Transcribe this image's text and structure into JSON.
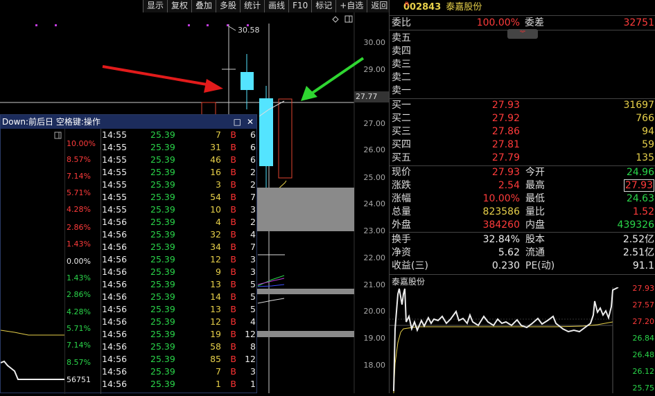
{
  "toolbar": {
    "items": [
      "显示",
      "复权",
      "叠加",
      "多股",
      "统计",
      "画线",
      "F10",
      "标记",
      "+自选",
      "返回"
    ]
  },
  "main_chart": {
    "price_labels": [
      "30.00",
      "29.00",
      "27.00",
      "26.00",
      "25.00",
      "24.00",
      "23.00",
      "22.00",
      "21.00",
      "20.00",
      "19.00",
      "18.00"
    ],
    "current_price_tag": "27.77",
    "high_annotation": "30.58",
    "candles": [
      {
        "open": 27.5,
        "close": 27.9,
        "high": 27.9,
        "low": 27.5,
        "color": "hollow-red"
      },
      {
        "open": 29.0,
        "close": 29.0,
        "high": 30.58,
        "low": 27.5,
        "color": "cross"
      },
      {
        "open": 28.4,
        "close": 29.1,
        "high": 29.55,
        "low": 27.5,
        "color": "cyan"
      },
      {
        "open": 27.95,
        "close": 25.4,
        "high": 28.3,
        "low": 25.2,
        "color": "cyan"
      },
      {
        "open": 25.2,
        "close": 27.95,
        "high": 27.95,
        "low": 25.2,
        "color": "hollow-red"
      }
    ],
    "colors": {
      "bg": "#000000",
      "cyan": "#54e4ff",
      "red": "#e2442f",
      "arrow_red": "#e21b1b",
      "arrow_green": "#2fd631",
      "volume_gray": "#8a8a8a"
    }
  },
  "popup": {
    "title": "Down:前后日 空格键:操作",
    "maximize_icon": "□",
    "close_icon": "✕",
    "pct_labels": [
      {
        "text": "10.00%",
        "color": "red"
      },
      {
        "text": "8.57%",
        "color": "red"
      },
      {
        "text": "7.14%",
        "color": "red"
      },
      {
        "text": "5.71%",
        "color": "red"
      },
      {
        "text": "4.28%",
        "color": "red"
      },
      {
        "text": "2.86%",
        "color": "red"
      },
      {
        "text": "1.43%",
        "color": "red"
      },
      {
        "text": "0.00%",
        "color": "white"
      },
      {
        "text": "1.43%",
        "color": "green"
      },
      {
        "text": "2.86%",
        "color": "green"
      },
      {
        "text": "4.28%",
        "color": "green"
      },
      {
        "text": "5.71%",
        "color": "green"
      },
      {
        "text": "7.14%",
        "color": "green"
      },
      {
        "text": "8.57%",
        "color": "green"
      },
      {
        "text": "56751",
        "color": "white"
      }
    ],
    "trades": [
      {
        "time": "14:55",
        "price": "25.39",
        "vol": "7",
        "side": "B",
        "num": "6"
      },
      {
        "time": "14:55",
        "price": "25.39",
        "vol": "31",
        "side": "B",
        "num": "6"
      },
      {
        "time": "14:55",
        "price": "25.39",
        "vol": "46",
        "side": "B",
        "num": "6"
      },
      {
        "time": "14:55",
        "price": "25.39",
        "vol": "16",
        "side": "B",
        "num": "2"
      },
      {
        "time": "14:55",
        "price": "25.39",
        "vol": "3",
        "side": "B",
        "num": "2"
      },
      {
        "time": "14:55",
        "price": "25.39",
        "vol": "54",
        "side": "B",
        "num": "7"
      },
      {
        "time": "14:55",
        "price": "25.39",
        "vol": "10",
        "side": "B",
        "num": "3"
      },
      {
        "time": "14:56",
        "price": "25.39",
        "vol": "4",
        "side": "B",
        "num": "2"
      },
      {
        "time": "14:56",
        "price": "25.39",
        "vol": "32",
        "side": "B",
        "num": "4"
      },
      {
        "time": "14:56",
        "price": "25.39",
        "vol": "34",
        "side": "B",
        "num": "7"
      },
      {
        "time": "14:56",
        "price": "25.39",
        "vol": "12",
        "side": "B",
        "num": "3"
      },
      {
        "time": "14:56",
        "price": "25.39",
        "vol": "9",
        "side": "B",
        "num": "3"
      },
      {
        "time": "14:56",
        "price": "25.39",
        "vol": "13",
        "side": "B",
        "num": "5"
      },
      {
        "time": "14:56",
        "price": "25.39",
        "vol": "14",
        "side": "B",
        "num": "5"
      },
      {
        "time": "14:56",
        "price": "25.39",
        "vol": "13",
        "side": "B",
        "num": "5"
      },
      {
        "time": "14:56",
        "price": "25.39",
        "vol": "12",
        "side": "B",
        "num": "4"
      },
      {
        "time": "14:56",
        "price": "25.39",
        "vol": "19",
        "side": "B",
        "num": "12"
      },
      {
        "time": "14:56",
        "price": "25.39",
        "vol": "58",
        "side": "B",
        "num": "8"
      },
      {
        "time": "14:56",
        "price": "25.39",
        "vol": "85",
        "side": "B",
        "num": "12"
      },
      {
        "time": "14:56",
        "price": "25.39",
        "vol": "7",
        "side": "B",
        "num": "3"
      },
      {
        "time": "14:56",
        "price": "25.39",
        "vol": "1",
        "side": "B",
        "num": "1"
      }
    ]
  },
  "right_panel": {
    "r_badge": "R",
    "code": "002843",
    "name": "泰嘉股份",
    "weibi_label": "委比",
    "weibi_value": "100.00%",
    "weicha_label": "委差",
    "weicha_value": "32751",
    "sells": [
      "卖五",
      "卖四",
      "卖三",
      "卖二",
      "卖一"
    ],
    "buys": [
      {
        "label": "买一",
        "price": "27.93",
        "vol": "31697"
      },
      {
        "label": "买二",
        "price": "27.92",
        "vol": "766"
      },
      {
        "label": "买三",
        "price": "27.86",
        "vol": "94"
      },
      {
        "label": "买四",
        "price": "27.81",
        "vol": "59"
      },
      {
        "label": "买五",
        "price": "27.79",
        "vol": "135"
      }
    ],
    "stats": [
      {
        "l1": "现价",
        "v1": "27.93",
        "c1": "red",
        "l2": "今开",
        "v2": "24.96",
        "c2": "green"
      },
      {
        "l1": "涨跌",
        "v1": "2.54",
        "c1": "red",
        "l2": "最高",
        "v2": "27.93",
        "c2": "red-box"
      },
      {
        "l1": "涨幅",
        "v1": "10.00%",
        "c1": "red",
        "l2": "最低",
        "v2": "24.63",
        "c2": "green"
      },
      {
        "l1": "总量",
        "v1": "823586",
        "c1": "yellow",
        "l2": "量比",
        "v2": "1.52",
        "c2": "red"
      },
      {
        "l1": "外盘",
        "v1": "384260",
        "c1": "red",
        "l2": "内盘",
        "v2": "439326",
        "c2": "green"
      }
    ],
    "stats2": [
      {
        "l1": "换手",
        "v1": "32.84%",
        "l2": "股本",
        "v2": "2.52亿"
      },
      {
        "l1": "净资",
        "v1": "5.62",
        "l2": "流通",
        "v2": "2.51亿"
      },
      {
        "l1": "收益(三)",
        "v1": "0.230",
        "l2": "PE(动)",
        "v2": "91.1"
      }
    ],
    "chart_label": "泰嘉股份",
    "chart_prices": [
      {
        "text": "27.93",
        "color": "red"
      },
      {
        "text": "27.57",
        "color": "red"
      },
      {
        "text": "27.20",
        "color": "red"
      },
      {
        "text": "26.84",
        "color": "green"
      },
      {
        "text": "26.48",
        "color": "green"
      },
      {
        "text": "26.12",
        "color": "green"
      },
      {
        "text": "25.75",
        "color": "green"
      }
    ]
  }
}
